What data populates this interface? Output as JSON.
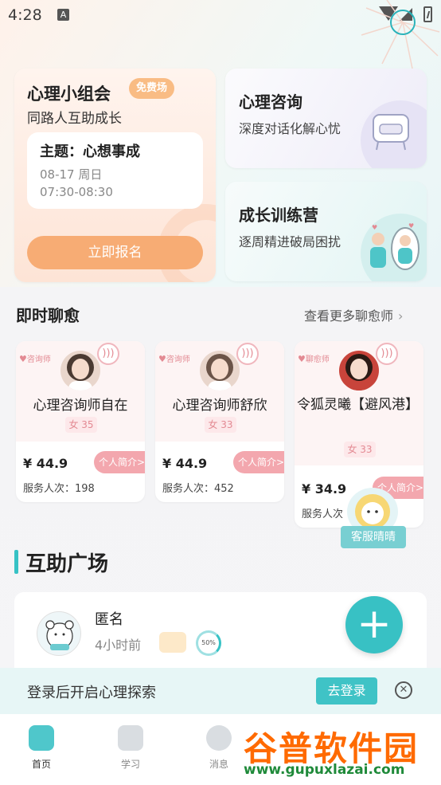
{
  "status_bar": {
    "time": "4:28"
  },
  "group": {
    "title": "心理小组会",
    "free_badge": "免费场",
    "subtitle": "同路人互助成长",
    "topic": "主题：心想事成",
    "date": "08-17 周日",
    "time": "07:30-08:30",
    "join_button": "立即报名"
  },
  "consult": {
    "title": "心理咨询",
    "subtitle": "深度对话化解心忧"
  },
  "camp": {
    "title": "成长训练营",
    "subtitle": "逐周精进破局困扰"
  },
  "chat_section": {
    "title": "即时聊愈",
    "more_link": "查看更多聊愈师"
  },
  "counselors": [
    {
      "badge": "咨询师",
      "name": "心理咨询师自在",
      "gender_age": "女 35",
      "price": "¥ 44.9",
      "intro_button": "个人简介>",
      "served": "服务人次：198"
    },
    {
      "badge": "咨询师",
      "name": "心理咨询师舒欣",
      "gender_age": "女 33",
      "price": "¥ 44.9",
      "intro_button": "个人简介>",
      "served": "服务人次：452"
    },
    {
      "badge": "聊愈师",
      "name": "令狐灵曦【避风港】",
      "gender_age": "女 33",
      "price": "¥ 34.9",
      "intro_button": "个人简介>",
      "served": "服务人次"
    }
  ],
  "customer_service": {
    "label": "客服晴晴"
  },
  "mutual_help": {
    "title": "互助广场"
  },
  "post": {
    "author": "匿名",
    "time_ago": "4小时前",
    "progress": "50%"
  },
  "fab": {
    "label": "+"
  },
  "login_banner": {
    "text": "登录后开启心理探索",
    "button": "去登录",
    "close": "✕"
  },
  "nav": {
    "items": [
      {
        "label": "首页"
      },
      {
        "label": "学习"
      },
      {
        "label": "消息"
      }
    ]
  },
  "watermark": {
    "title": "谷普软件园",
    "url": "www.gupuxlazai.com"
  },
  "colors": {
    "accent": "#38c1c4",
    "orange": "#f7ac74",
    "pink": "#f3a7ae"
  }
}
